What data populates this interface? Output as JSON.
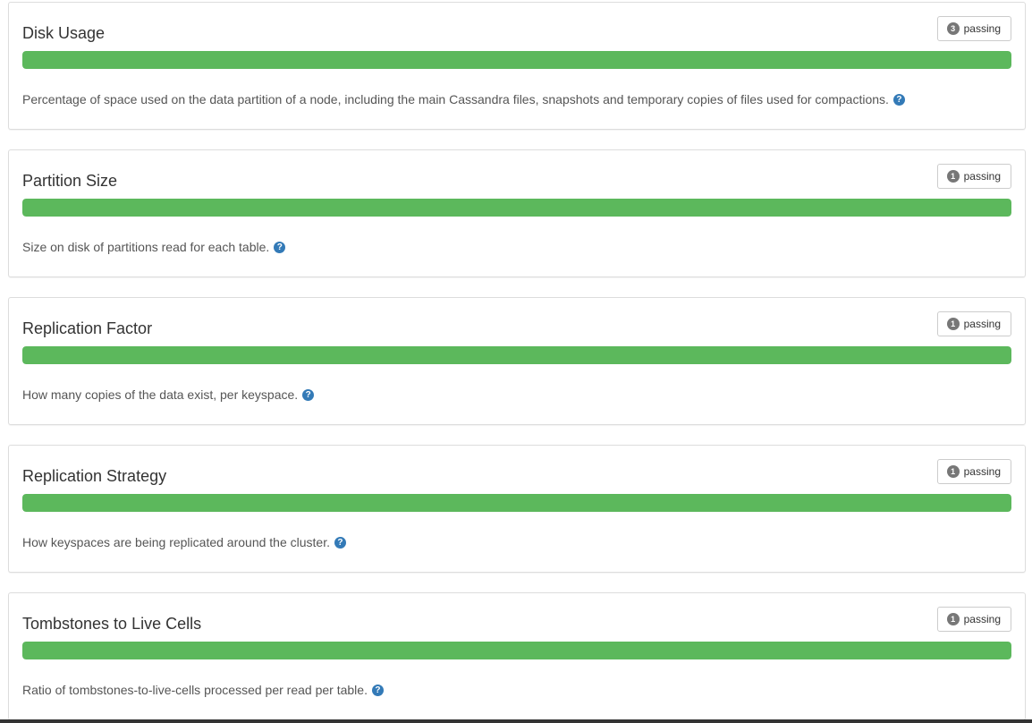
{
  "panels": [
    {
      "title": "Disk Usage",
      "count": "3",
      "status": "passing",
      "progress_pct": 100,
      "description": "Percentage of space used on the data partition of a node, including the main Cassandra files, snapshots and temporary copies of files used for compactions.",
      "help_icon": "question-circle-icon"
    },
    {
      "title": "Partition Size",
      "count": "1",
      "status": "passing",
      "progress_pct": 100,
      "description": "Size on disk of partitions read for each table.",
      "help_icon": "question-circle-icon"
    },
    {
      "title": "Replication Factor",
      "count": "1",
      "status": "passing",
      "progress_pct": 100,
      "description": "How many copies of the data exist, per keyspace.",
      "help_icon": "question-circle-icon"
    },
    {
      "title": "Replication Strategy",
      "count": "1",
      "status": "passing",
      "progress_pct": 100,
      "description": "How keyspaces are being replicated around the cluster.",
      "help_icon": "question-circle-icon"
    },
    {
      "title": "Tombstones to Live Cells",
      "count": "1",
      "status": "passing",
      "progress_pct": 100,
      "description": "Ratio of tombstones-to-live-cells processed per read per table.",
      "help_icon": "question-circle-icon"
    }
  ],
  "colors": {
    "success": "#5cb85c",
    "help": "#337ab7",
    "badge": "#777777"
  }
}
